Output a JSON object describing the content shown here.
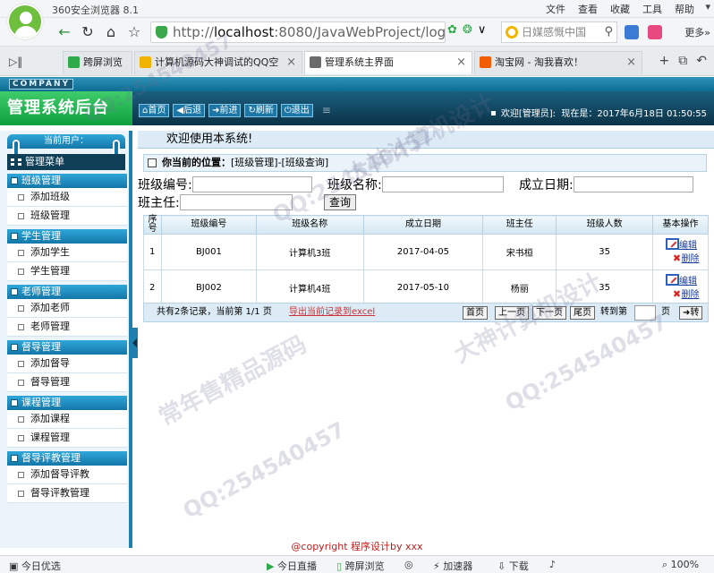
{
  "browser": {
    "app_title": "360安全浏览器 8.1",
    "top_menu": [
      "文件",
      "查看",
      "收藏",
      "工具",
      "帮助"
    ],
    "address": {
      "prefix": "http://",
      "host": "localhost",
      "rest": ":8080/JavaWebProject/login/log"
    },
    "search_placeholder": "日媒感慨中国",
    "more_label": "更多",
    "tabs": [
      {
        "label": "跨屏浏览",
        "icon_color": "#2eaa4a"
      },
      {
        "label": "计算机源码大神调试的QQ空",
        "icon_color": "#f0b400"
      },
      {
        "label": "管理系统主界面",
        "icon_color": "#6b6b6b",
        "active": true
      },
      {
        "label": "淘宝网 - 淘我喜欢！",
        "icon_color": "#f25c05"
      }
    ],
    "status_items": [
      "今日优选",
      "今日直播",
      "跨屏浏览",
      "加速器",
      "下载",
      "100%"
    ]
  },
  "app": {
    "company": "COMPANY",
    "title": "管理系统后台",
    "nav_buttons": [
      "首页",
      "后退",
      "前进",
      "刷新",
      "退出"
    ],
    "welcome": "欢迎[管理员]:",
    "now_label": "现在是：",
    "datetime": "2017年6月18日  01:50:55",
    "current_user_label": "当前用户：",
    "menu_title": "管理菜单",
    "menu_groups": [
      {
        "title": "班级管理",
        "items": [
          "添加班级",
          "班级管理"
        ]
      },
      {
        "title": "学生管理",
        "items": [
          "添加学生",
          "学生管理"
        ]
      },
      {
        "title": "老师管理",
        "items": [
          "添加老师",
          "老师管理"
        ]
      },
      {
        "title": "督导管理",
        "items": [
          "添加督导",
          "督导管理"
        ]
      },
      {
        "title": "课程管理",
        "items": [
          "添加课程",
          "课程管理"
        ]
      },
      {
        "title": "督导评教管理",
        "items": [
          "添加督导评教",
          "督导评教管理"
        ]
      }
    ],
    "welcome_msg": "欢迎使用本系统!",
    "location_label": "你当前的位置：",
    "location": "[班级管理]-[班级查询]",
    "search_form": {
      "class_no_label": "班级编号:",
      "class_name_label": "班级名称:",
      "date_label": "成立日期:",
      "teacher_label": "班主任:",
      "query_button": "查询"
    },
    "table": {
      "headers": [
        "序号",
        "班级编号",
        "班级名称",
        "成立日期",
        "班主任",
        "班级人数",
        "基本操作"
      ],
      "rows": [
        {
          "seq": "1",
          "no": "BJ001",
          "name": "计算机3班",
          "date": "2017-04-05",
          "teacher": "宋书桓",
          "count": "35"
        },
        {
          "seq": "2",
          "no": "BJ002",
          "name": "计算机4班",
          "date": "2017-05-10",
          "teacher": "杨丽",
          "count": "35"
        }
      ],
      "edit_label": "编辑",
      "delete_label": "删除"
    },
    "pager": {
      "info": "共有2条记录，当前第 1/1 页",
      "export": "导出当前记录到excel",
      "buttons": [
        "首页",
        "上一页",
        "下一页",
        "尾页"
      ],
      "goto_label": "转到第",
      "page_unit": "页",
      "go_button": "转"
    },
    "footer": "@copyright  程序设计by xxx"
  },
  "watermarks": [
    "QQ:254540457",
    "大神计算机设计",
    "常年售精品源码"
  ]
}
